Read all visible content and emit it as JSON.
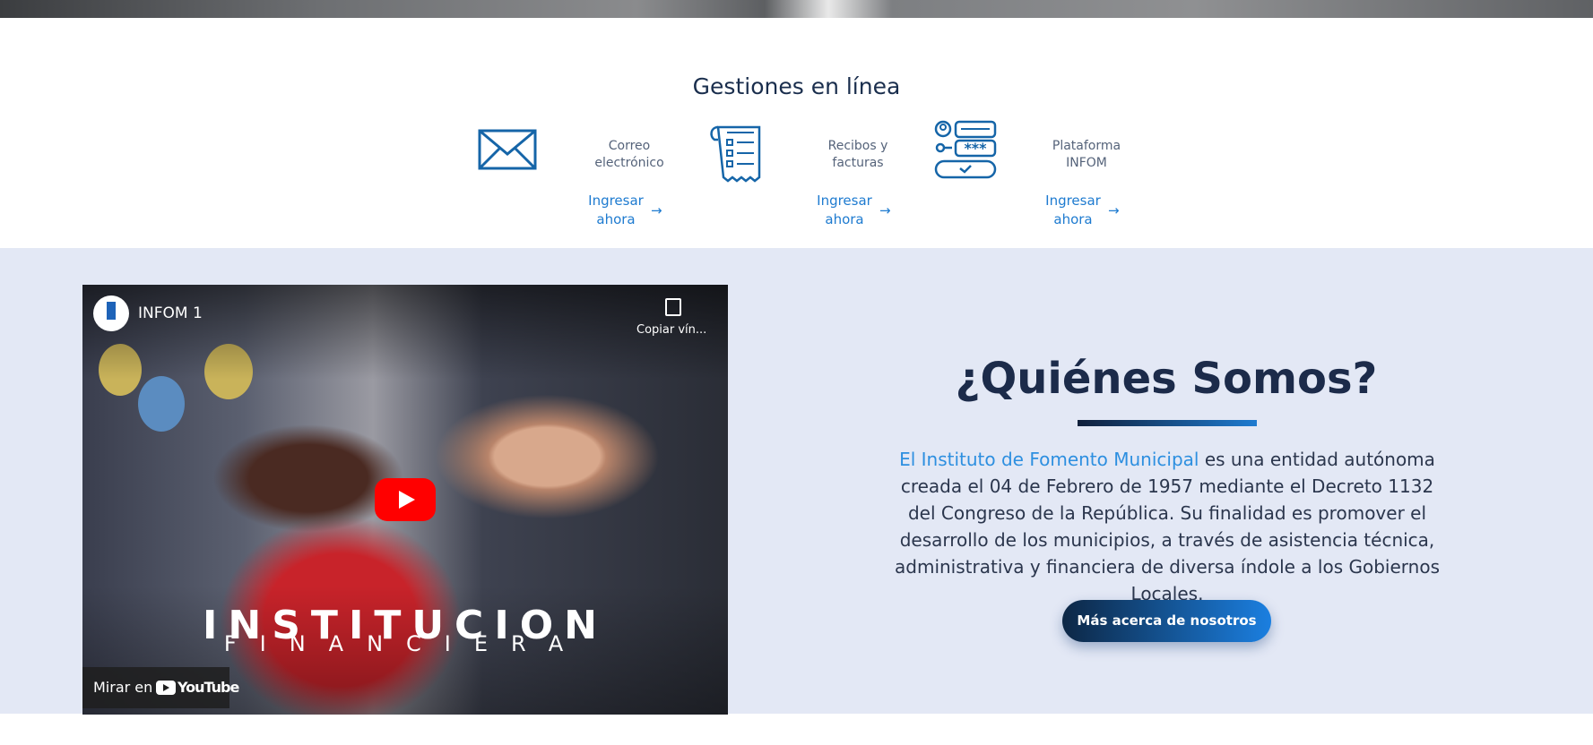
{
  "gestiones": {
    "title": "Gestiones en línea",
    "items": [
      {
        "label": "Correo electrónico",
        "cta": "Ingresar ahora",
        "icon": "envelope-icon"
      },
      {
        "label": "Recibos y facturas",
        "cta": "Ingresar ahora",
        "icon": "receipt-icon"
      },
      {
        "label": "Plataforma INFOM",
        "cta": "Ingresar ahora",
        "icon": "login-form-icon"
      }
    ],
    "arrow": "→"
  },
  "video": {
    "title": "INFOM 1",
    "copy_label": "Copiar vín...",
    "overlay_line1": "INSTITUCION",
    "overlay_line2": "FINANCIERA",
    "watch_label": "Mirar en",
    "youtube_label": "YouTube"
  },
  "about": {
    "title": "¿Quiénes Somos?",
    "link_text": "El Instituto de Fomento Municipal",
    "body": " es una entidad autónoma creada el 04 de Febrero de 1957 mediante el Decreto 1132 del Congreso de la República. Su finalidad es promover el desarrollo de los municipios, a través de asistencia técnica, administrativa y financiera de diversa índole a los Gobiernos Locales.",
    "button": "Más acerca de nosotros"
  },
  "colors": {
    "accent": "#1e7bd0",
    "heading": "#1c2b4a",
    "section_bg": "#e3e8f5",
    "play_button": "#ff0000"
  }
}
